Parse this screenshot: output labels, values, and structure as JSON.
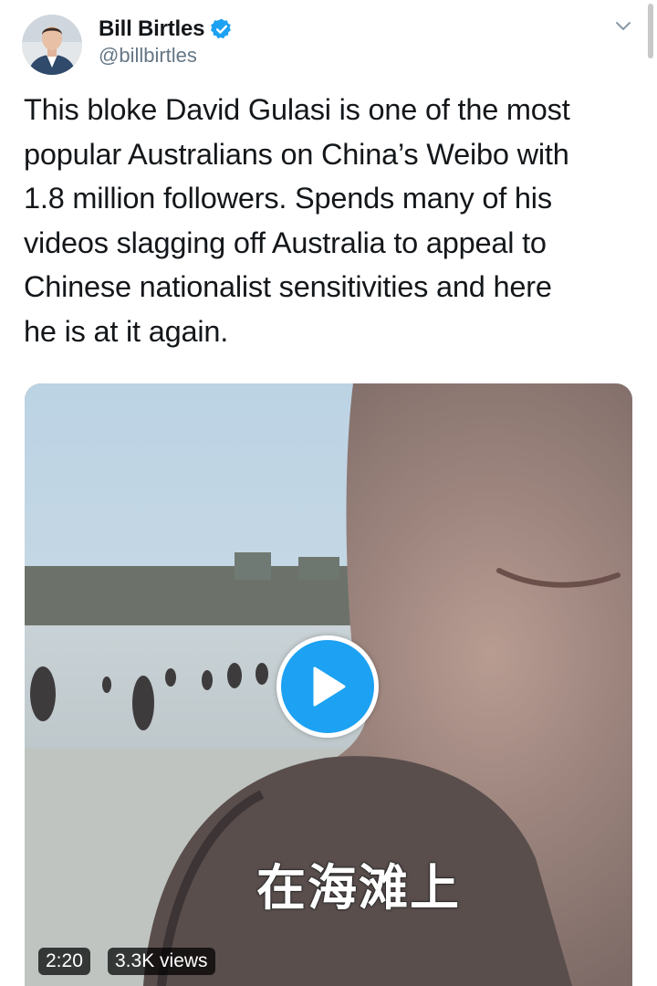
{
  "author": {
    "display_name": "Bill Birtles",
    "handle": "@billbirtles",
    "verified": true
  },
  "tweet": {
    "text": "This bloke David Gulasi is one of the most\npopular Australians on China’s Weibo with\n1.8 million followers. Spends many of his\nvideos slagging off Australia to appeal to\nChinese nationalist sensitivities and here\nhe is at it again."
  },
  "video": {
    "subtitle": "在海滩上",
    "duration": "2:20",
    "views": "3.3K views"
  },
  "icons": {
    "verified": "verified-badge-icon",
    "menu": "chevron-down-icon",
    "play": "play-icon"
  },
  "colors": {
    "accent": "#1da1f2",
    "text": "#14171a",
    "secondary_text": "#657786"
  }
}
